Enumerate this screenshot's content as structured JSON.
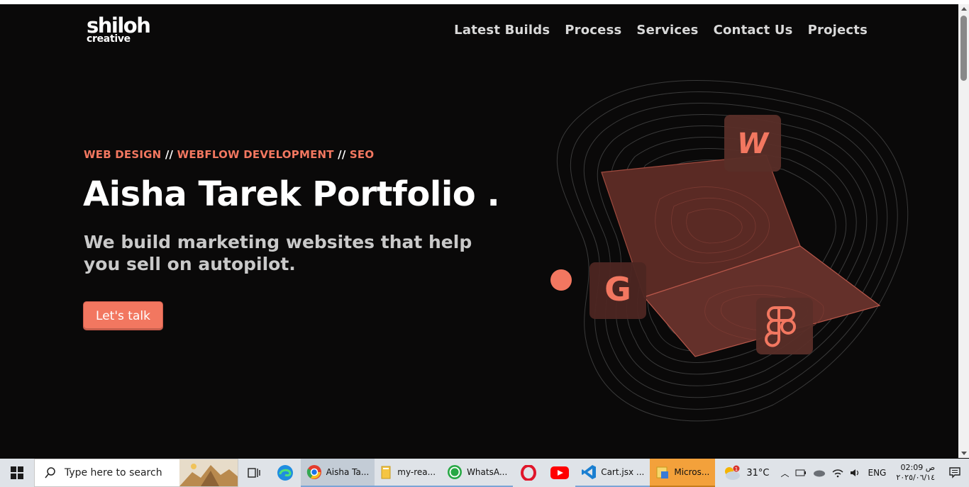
{
  "site": {
    "logo_main": "shiloh",
    "logo_sub": "creative",
    "nav": [
      "Latest Builds",
      "Process",
      "Services",
      "Contact Us",
      "Projects"
    ]
  },
  "hero": {
    "tag_1": "WEB DESIGN",
    "sep": " // ",
    "tag_2": "WEBFLOW DEVELOPMENT",
    "tag_3": "SEO",
    "title": "Aisha Tarek Portfolio .",
    "subtitle": "We build marketing websites that help you sell on autopilot.",
    "cta": "Let's talk"
  },
  "illustration": {
    "badge_webflow": "W",
    "badge_google": "G",
    "badge_figma": "figma-icon",
    "accent": "#f27760"
  },
  "taskbar": {
    "search_placeholder": "Type here to search",
    "apps": [
      {
        "label": "Aisha Ta...",
        "icon": "chrome-icon"
      },
      {
        "label": "my-rea...",
        "icon": "folder-icon"
      },
      {
        "label": "WhatsA...",
        "icon": "whatsapp-icon"
      },
      {
        "label": "Cart.jsx ...",
        "icon": "vscode-icon"
      },
      {
        "label": "Micros...",
        "icon": "microsoft-icon"
      }
    ],
    "weather": "31°C",
    "weather_badge": "1",
    "language": "ENG",
    "time": "02:09 ص",
    "date": "٢٠٢٥/٠٦/١٤"
  },
  "colors": {
    "accent": "#f27760",
    "background": "#0a0909"
  }
}
